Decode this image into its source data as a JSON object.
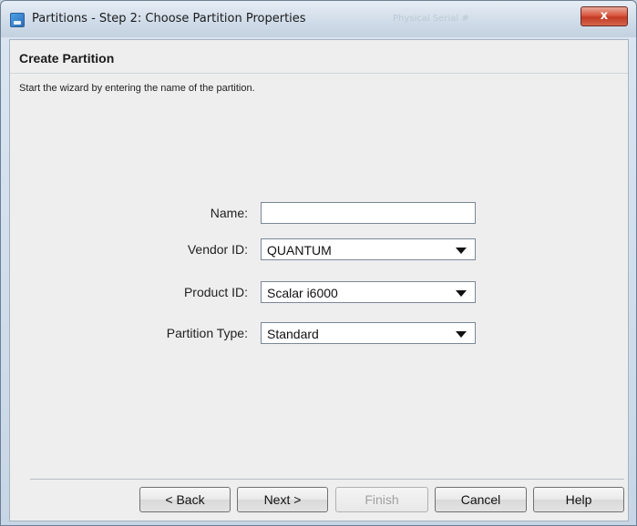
{
  "window": {
    "title": "Partitions - Step 2: Choose Partition Properties",
    "background_title_text": "Physical Serial #",
    "close_label": "x"
  },
  "header": {
    "title": "Create Partition",
    "subtitle": "Start the wizard by entering the name of the partition."
  },
  "form": {
    "name": {
      "label": "Name:",
      "value": "",
      "placeholder": ""
    },
    "vendor_id": {
      "label": "Vendor ID:",
      "value": "QUANTUM"
    },
    "product_id": {
      "label": "Product ID:",
      "value": "Scalar i6000"
    },
    "partition_type": {
      "label": "Partition Type:",
      "value": "Standard"
    }
  },
  "buttons": {
    "back": "< Back",
    "next": "Next >",
    "finish": "Finish",
    "cancel": "Cancel",
    "help": "Help"
  },
  "icons": {
    "app": "partition-wizard-icon",
    "dropdown": "chevron-down-icon"
  },
  "colors": {
    "titlebar": "#cfdbe8",
    "close_button": "#c23a24",
    "dialog_body": "#eeeeee"
  }
}
